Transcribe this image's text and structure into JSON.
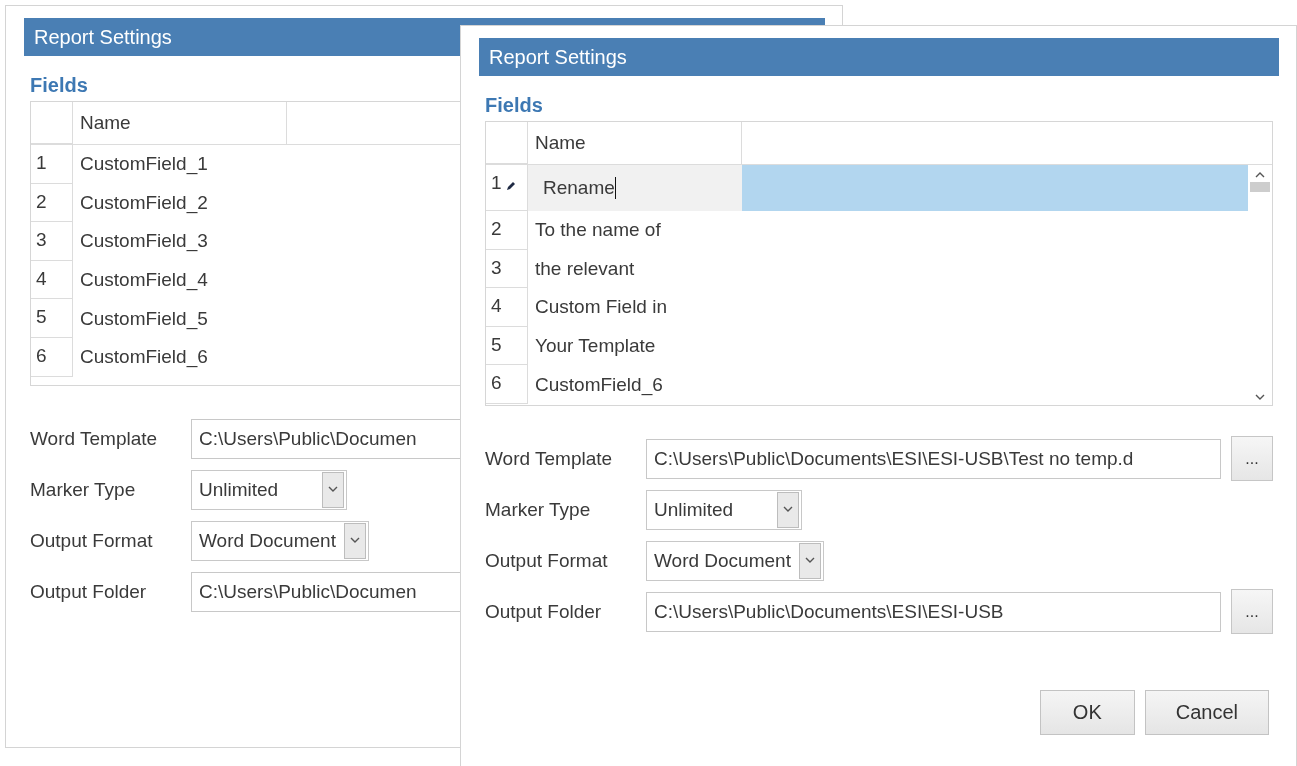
{
  "windows": [
    {
      "title": "Report Settings",
      "section": "Fields",
      "columns": [
        "Name"
      ],
      "rows": [
        {
          "index": "1",
          "name": "CustomField_1",
          "editing": false,
          "selected": false
        },
        {
          "index": "2",
          "name": "CustomField_2",
          "editing": false,
          "selected": false
        },
        {
          "index": "3",
          "name": "CustomField_3",
          "editing": false,
          "selected": false
        },
        {
          "index": "4",
          "name": "CustomField_4",
          "editing": false,
          "selected": false
        },
        {
          "index": "5",
          "name": "CustomField_5",
          "editing": false,
          "selected": false
        },
        {
          "index": "6",
          "name": "CustomField_6",
          "editing": false,
          "selected": false
        }
      ],
      "form": [
        {
          "kind": "path",
          "label": "Word Template",
          "value": "C:\\Users\\Public\\Documen"
        },
        {
          "kind": "select",
          "label": "Marker Type",
          "value": "Unlimited"
        },
        {
          "kind": "select",
          "label": "Output Format",
          "value": "Word Document"
        },
        {
          "kind": "path",
          "label": "Output Folder",
          "value": "C:\\Users\\Public\\Documen"
        }
      ]
    },
    {
      "title": "Report Settings",
      "section": "Fields",
      "columns": [
        "Name"
      ],
      "scrollable": true,
      "rows": [
        {
          "index": "1",
          "name": "Rename",
          "editing": true,
          "selected": true
        },
        {
          "index": "2",
          "name": "To the name of",
          "editing": false,
          "selected": false
        },
        {
          "index": "3",
          "name": "the relevant",
          "editing": false,
          "selected": false
        },
        {
          "index": "4",
          "name": "Custom Field in",
          "editing": false,
          "selected": false
        },
        {
          "index": "5",
          "name": "Your Template",
          "editing": false,
          "selected": false
        },
        {
          "index": "6",
          "name": "CustomField_6",
          "editing": false,
          "selected": false
        }
      ],
      "form": [
        {
          "kind": "path",
          "label": "Word Template",
          "value": "C:\\Users\\Public\\Documents\\ESI\\ESI-USB\\Test no temp.d",
          "browse": "..."
        },
        {
          "kind": "select",
          "label": "Marker Type",
          "value": "Unlimited"
        },
        {
          "kind": "select",
          "label": "Output Format",
          "value": "Word Document"
        },
        {
          "kind": "path",
          "label": "Output Folder",
          "value": "C:\\Users\\Public\\Documents\\ESI\\ESI-USB",
          "browse": "..."
        }
      ],
      "buttons": [
        "OK",
        "Cancel"
      ]
    }
  ]
}
